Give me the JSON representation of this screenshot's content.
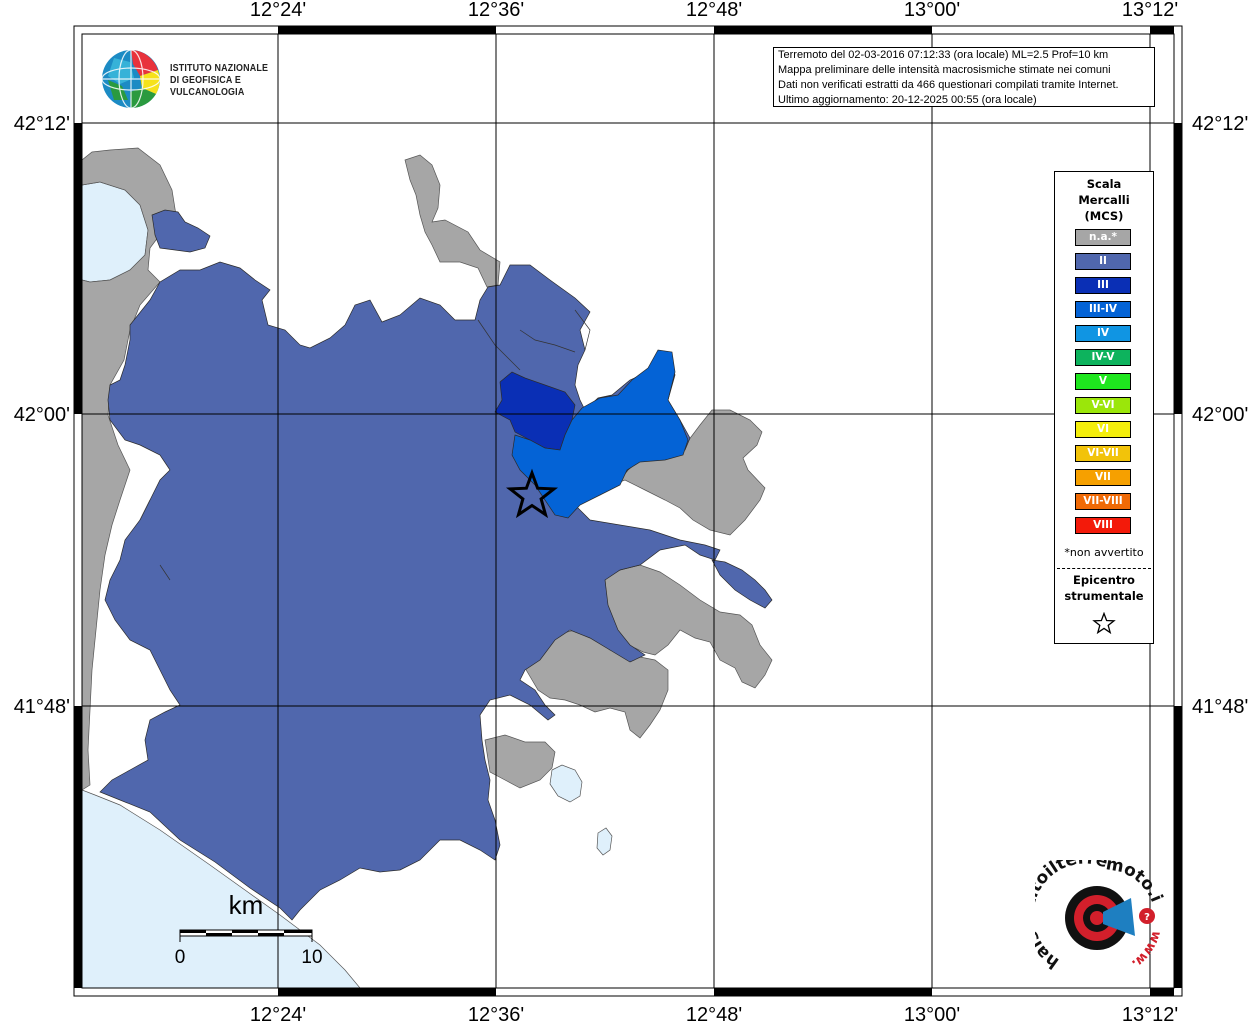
{
  "map": {
    "lon_labels": [
      "12°24'",
      "12°36'",
      "12°48'",
      "13°00'",
      "13°12'"
    ],
    "lat_labels": [
      "42°12'",
      "42°00'",
      "41°48'"
    ],
    "colors": {
      "na": "#a6a6a6",
      "II": "#5067ad",
      "III": "#0a2fb5",
      "III-IV": "#0463d6",
      "sea": "#dff0fb",
      "lake": "#dff0fb",
      "grid": "#000000"
    },
    "scale_bar": {
      "unit": "km",
      "start_label": "0",
      "end_label": "10"
    },
    "epicenter_icon": "star-icon"
  },
  "info": {
    "line1": "Terremoto del 02-03-2016 07:12:33 (ora locale) ML=2.5 Prof=10 km",
    "line2": "Mappa preliminare delle intensità macrosismiche stimate nei comuni",
    "line3": "Dati non verificati estratti da 466 questionari compilati tramite Internet.",
    "line4": "Ultimo aggiornamento: 20-12-2025 00:55 (ora locale)"
  },
  "logo": {
    "icon": "ingv-globe-icon",
    "line1": "ISTITUTO NAZIONALE",
    "line2": "DI GEOFISICA E VULCANOLOGIA"
  },
  "legend": {
    "title_line1": "Scala",
    "title_line2": "Mercalli",
    "title_line3": "(MCS)",
    "items": [
      {
        "label": "n.a.*",
        "color": "#a6a6a6"
      },
      {
        "label": "II",
        "color": "#5067ad"
      },
      {
        "label": "III",
        "color": "#0a2fb5"
      },
      {
        "label": "III-IV",
        "color": "#0463d6"
      },
      {
        "label": "IV",
        "color": "#1095e3"
      },
      {
        "label": "IV-V",
        "color": "#0db35d"
      },
      {
        "label": "V",
        "color": "#1ee61e"
      },
      {
        "label": "V-VI",
        "color": "#9be60a"
      },
      {
        "label": "VI",
        "color": "#f4ee0c"
      },
      {
        "label": "VI-VII",
        "color": "#f2c30a"
      },
      {
        "label": "VII",
        "color": "#f6a000"
      },
      {
        "label": "VII-VIII",
        "color": "#f06a06"
      },
      {
        "label": "VIII",
        "color": "#f31a0a"
      }
    ],
    "note": "*non avvertito",
    "epicenter_line1": "Epicentro",
    "epicenter_line2": "strumentale"
  },
  "hsit": {
    "icon": "hsit-logo-icon",
    "text_main": "haisentitoilterremoto.it",
    "text_www": "www."
  }
}
